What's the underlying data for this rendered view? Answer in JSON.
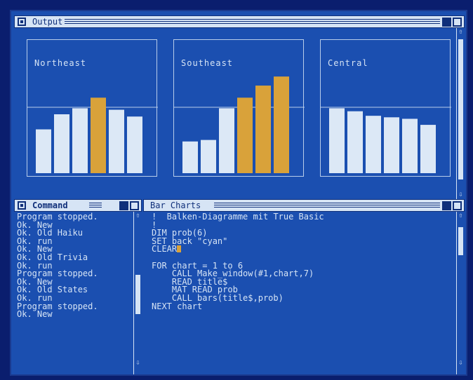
{
  "colors": {
    "screen_bg": "#1b4fb0",
    "bar_light": "#dce8f6",
    "bar_highlight": "#d9a23a",
    "text": "#d6e4f5"
  },
  "output_window": {
    "title": "Output",
    "panels": [
      {
        "title": "Northeast"
      },
      {
        "title": "Southeast"
      },
      {
        "title": "Central"
      }
    ]
  },
  "chart_data": [
    {
      "type": "bar",
      "title": "Northeast",
      "values": [
        58,
        78,
        86,
        100,
        84,
        75
      ],
      "highlighted": [
        3
      ]
    },
    {
      "type": "bar",
      "title": "Southeast",
      "values": [
        42,
        44,
        86,
        100,
        116,
        128
      ],
      "highlighted": [
        3,
        4,
        5
      ]
    },
    {
      "type": "bar",
      "title": "Central",
      "values": [
        86,
        82,
        76,
        74,
        72,
        64
      ],
      "highlighted": []
    }
  ],
  "command_window": {
    "title": "Command",
    "lines": [
      "Program stopped.",
      "Ok. New",
      "Ok. Old Haiku",
      "Ok. run",
      "Ok. New",
      "Ok. Old Trivia",
      "Ok. run",
      "Program stopped.",
      "Ok. New",
      "Ok. Old States",
      "Ok. run",
      "Program stopped.",
      "Ok. New"
    ]
  },
  "editor_window": {
    "title": "Bar Charts",
    "lines": [
      "!  Balken-Diagramme mit True Basic",
      "!",
      "DIM prob(6)",
      "SET back \"cyan\"",
      "CLEAR",
      "",
      "FOR chart = 1 to 6",
      "    CALL Make_window(#1,chart,7)",
      "    READ title$",
      "    MAT READ prob",
      "    CALL bars(title$,prob)",
      "NEXT chart"
    ]
  }
}
